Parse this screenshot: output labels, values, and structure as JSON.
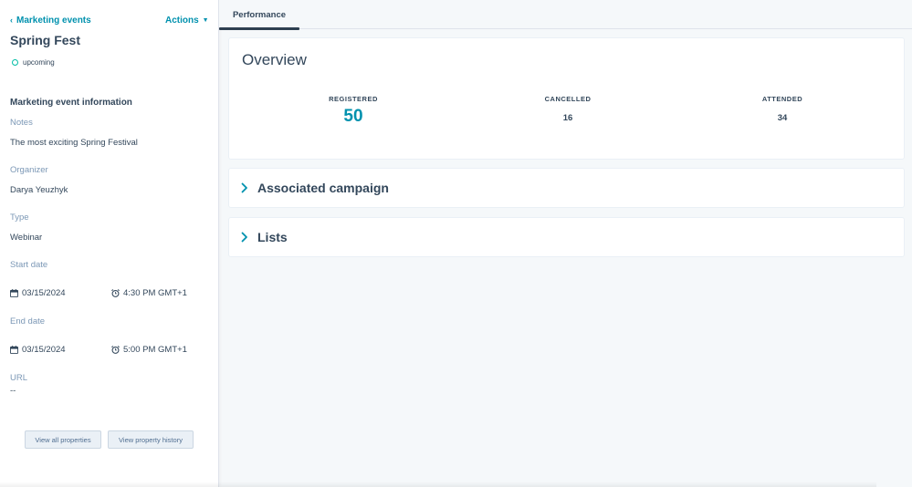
{
  "sidebar": {
    "back_link": "Marketing events",
    "actions_label": "Actions",
    "event_title": "Spring Fest",
    "status": "upcoming",
    "section_title": "Marketing event information",
    "notes": {
      "label": "Notes",
      "value": "The most exciting Spring Festival"
    },
    "organizer": {
      "label": "Organizer",
      "value": "Darya Yeuzhyk"
    },
    "type": {
      "label": "Type",
      "value": "Webinar"
    },
    "start_date": {
      "label": "Start date",
      "date": "03/15/2024",
      "time": "4:30 PM GMT+1"
    },
    "end_date": {
      "label": "End date",
      "date": "03/15/2024",
      "time": "5:00 PM GMT+1"
    },
    "url": {
      "label": "URL",
      "value": "--"
    },
    "buttons": {
      "view_all": "View all properties",
      "view_history": "View property history"
    }
  },
  "tabs": [
    {
      "label": "Performance",
      "active": true
    }
  ],
  "overview": {
    "title": "Overview",
    "metrics": [
      {
        "label": "REGISTERED",
        "value": "50"
      },
      {
        "label": "CANCELLED",
        "value": "16"
      },
      {
        "label": "ATTENDED",
        "value": "34"
      }
    ]
  },
  "sections": {
    "campaign": "Associated campaign",
    "lists": "Lists"
  },
  "colors": {
    "accent": "#0091ae",
    "text": "#33475b",
    "muted": "#7c98b6",
    "status_dot": "#00bda5",
    "background": "#f5f8fa"
  }
}
